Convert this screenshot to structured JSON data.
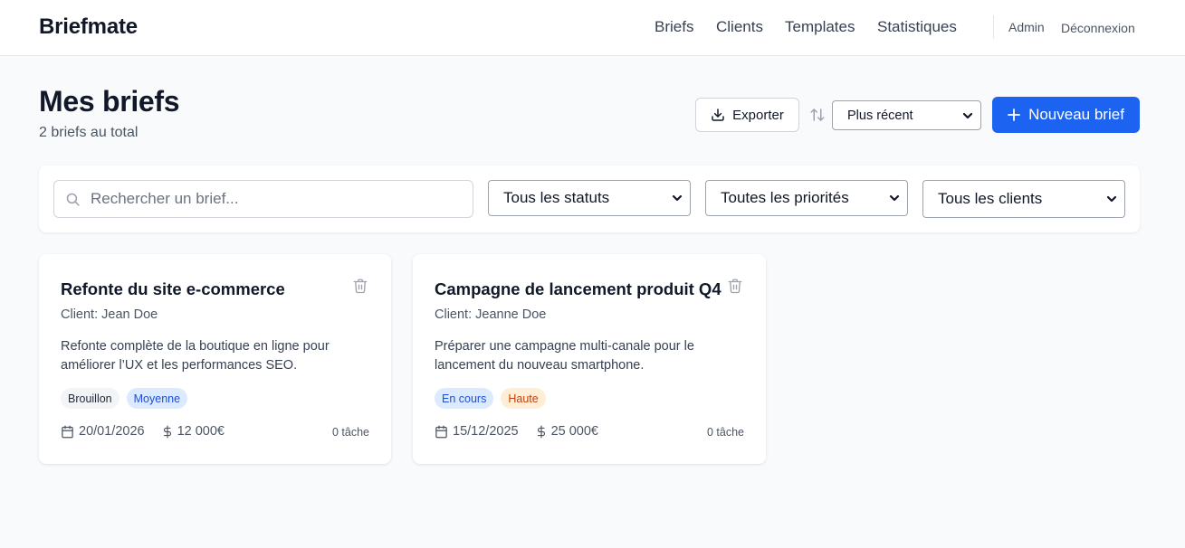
{
  "header": {
    "brand": "Briefmate",
    "nav": [
      "Briefs",
      "Clients",
      "Templates",
      "Statistiques"
    ],
    "admin": "Admin",
    "logout": "Déconnexion"
  },
  "page": {
    "title": "Mes briefs",
    "subtitle": "2 briefs au total",
    "export_label": "Exporter",
    "sort_value": "Plus récent",
    "new_label": "Nouveau brief"
  },
  "filters": {
    "search_placeholder": "Rechercher un brief...",
    "status": "Tous les statuts",
    "priority": "Toutes les priorités",
    "clients": "Tous les clients"
  },
  "briefs": [
    {
      "title": "Refonte du site e-commerce",
      "client": "Client: Jean Doe",
      "description": "Refonte complète de la boutique en ligne pour améliorer l’UX et les performances SEO.",
      "status": "Brouillon",
      "priority": "Moyenne",
      "date": "20/01/2026",
      "budget": "12 000€",
      "tasks": "0 tâche"
    },
    {
      "title": "Campagne de lancement produit Q4",
      "client": "Client: Jeanne Doe",
      "description": "Préparer une campagne multi-canale pour le lancement du nouveau smartphone.",
      "status": "En cours",
      "priority": "Haute",
      "date": "15/12/2025",
      "budget": "25 000€",
      "tasks": "0 tâche"
    }
  ],
  "colors": {
    "primary": "#1d63f2",
    "badge_gray": "#f3f4f6",
    "badge_blue": "#dbeafe",
    "badge_orange": "#ffedd5"
  },
  "icons": [
    "download-icon",
    "sort-icon",
    "plus-icon",
    "search-icon",
    "chevron-down-icon",
    "trash-icon",
    "calendar-icon",
    "dollar-icon"
  ]
}
